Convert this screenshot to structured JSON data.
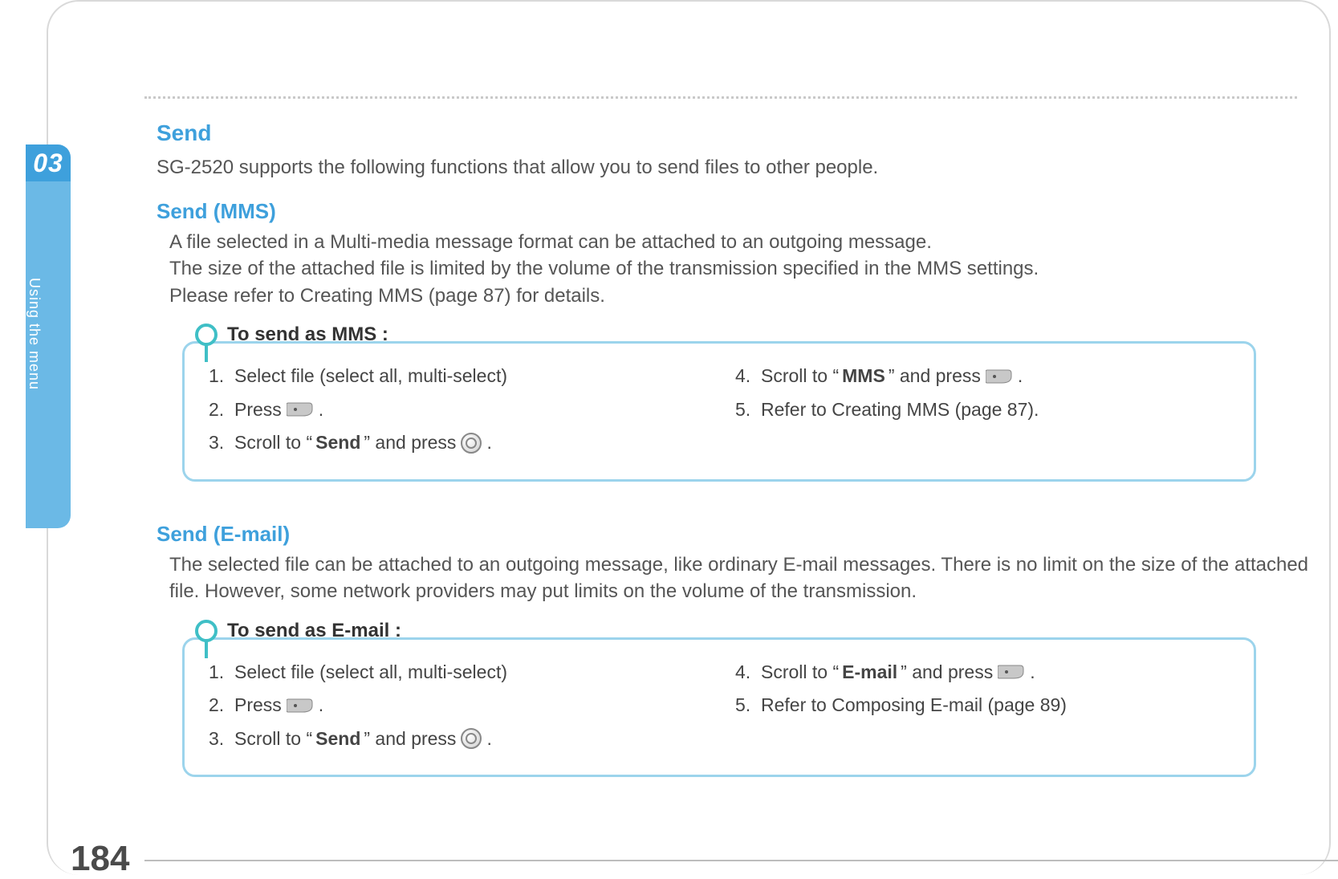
{
  "chapter": "03",
  "sideTab": "Using the menu",
  "pageNumber": "184",
  "send": {
    "title": "Send",
    "intro": "SG-2520 supports the following functions that allow you to send files to other people."
  },
  "mms": {
    "title": "Send (MMS)",
    "desc1": "A file selected in a Multi-media message format can be attached to an outgoing message.",
    "desc2": "The size of the attached file is limited by the volume of the transmission specified in the MMS settings.",
    "desc3": "Please refer to Creating MMS (page 87) for details.",
    "callout": "To send as MMS :",
    "steps": {
      "s1": "Select file (select all, multi-select)",
      "s2a": "Press ",
      "s3a": "Scroll to “",
      "s3b": "Send",
      "s3c": "” and press ",
      "s4a": "Scroll to “",
      "s4b": "MMS",
      "s4c": "” and press ",
      "s5": "Refer to Creating MMS (page 87)."
    }
  },
  "email": {
    "title": "Send (E-mail)",
    "desc": "The selected file can be attached to an outgoing message, like ordinary E-mail messages. There is no limit on the size of the attached file. However, some network providers may put limits on the volume of the transmission.",
    "callout": "To send as E-mail :",
    "steps": {
      "s1": "Select file (select all, multi-select)",
      "s2a": "Press ",
      "s3a": "Scroll to “",
      "s3b": "Send",
      "s3c": "” and press ",
      "s4a": "Scroll to “",
      "s4b": "E-mail",
      "s4c": "” and press ",
      "s5": "Refer to Composing E-mail (page 89)"
    }
  },
  "labels": {
    "n1": "1.",
    "n2": "2.",
    "n3": "3.",
    "n4": "4.",
    "n5": "5.",
    "period": "."
  }
}
